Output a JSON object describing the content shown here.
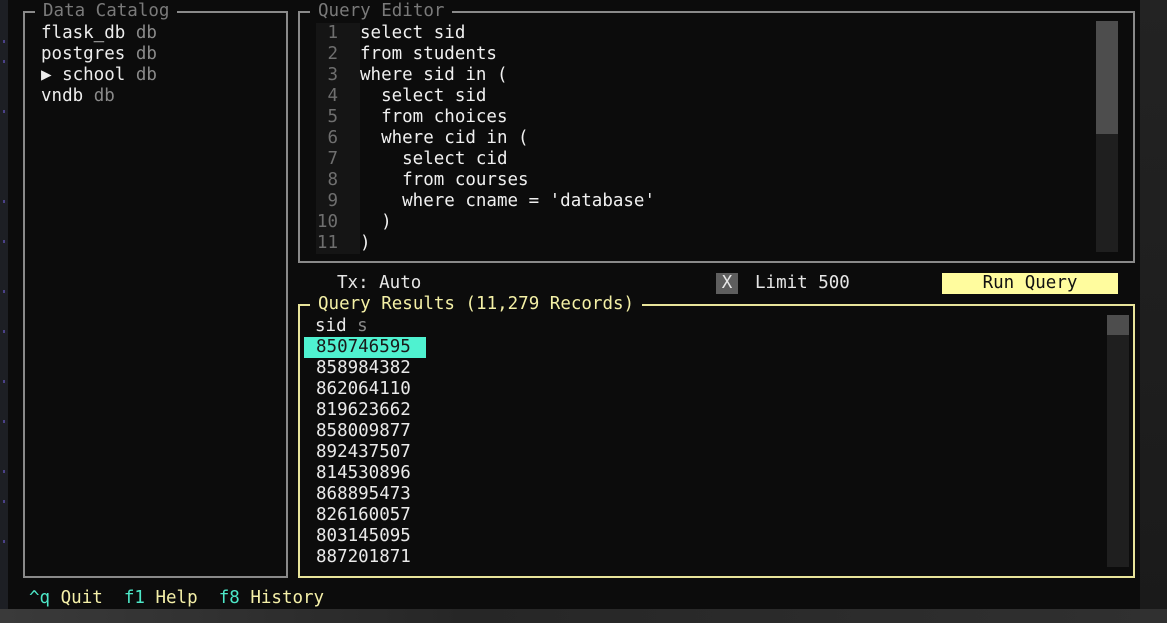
{
  "catalog": {
    "title": "Data Catalog",
    "items": [
      {
        "prefix": "",
        "name": "flask_db",
        "kind": "db"
      },
      {
        "prefix": "",
        "name": "postgres",
        "kind": "db"
      },
      {
        "prefix": "▶ ",
        "name": "school",
        "kind": "db"
      },
      {
        "prefix": "",
        "name": "vndb",
        "kind": "db"
      }
    ]
  },
  "editor": {
    "title": "Query Editor",
    "lines": [
      {
        "n": "1",
        "code": "select sid"
      },
      {
        "n": "2",
        "code": "from students"
      },
      {
        "n": "3",
        "code": "where sid in ("
      },
      {
        "n": "4",
        "code": "  select sid"
      },
      {
        "n": "5",
        "code": "  from choices"
      },
      {
        "n": "6",
        "code": "  where cid in ("
      },
      {
        "n": "7",
        "code": "    select cid"
      },
      {
        "n": "8",
        "code": "    from courses"
      },
      {
        "n": "9",
        "code": "    where cname = 'database'"
      },
      {
        "n": "10",
        "code": "  )"
      },
      {
        "n": "11",
        "code": ")"
      }
    ]
  },
  "controls": {
    "tx_label": "Tx: Auto",
    "limit_checkbox": "X",
    "limit_label": "Limit 500",
    "run_label": "Run Query"
  },
  "results": {
    "title": "Query Results (11,279 Records)",
    "column": "sid",
    "column_type": "s",
    "rows": [
      "850746595",
      "858984382",
      "862064110",
      "819623662",
      "858009877",
      "892437507",
      "814530896",
      "868895473",
      "826160057",
      "803145095",
      "887201871"
    ]
  },
  "footer": {
    "items": [
      {
        "key": "^q",
        "label": "Quit"
      },
      {
        "key": "f1",
        "label": "Help"
      },
      {
        "key": "f8",
        "label": "History"
      }
    ]
  },
  "colors": {
    "accent_yellow": "#fffc9e",
    "selection_teal": "#4ff2d0",
    "key_teal": "#4de8c8"
  }
}
